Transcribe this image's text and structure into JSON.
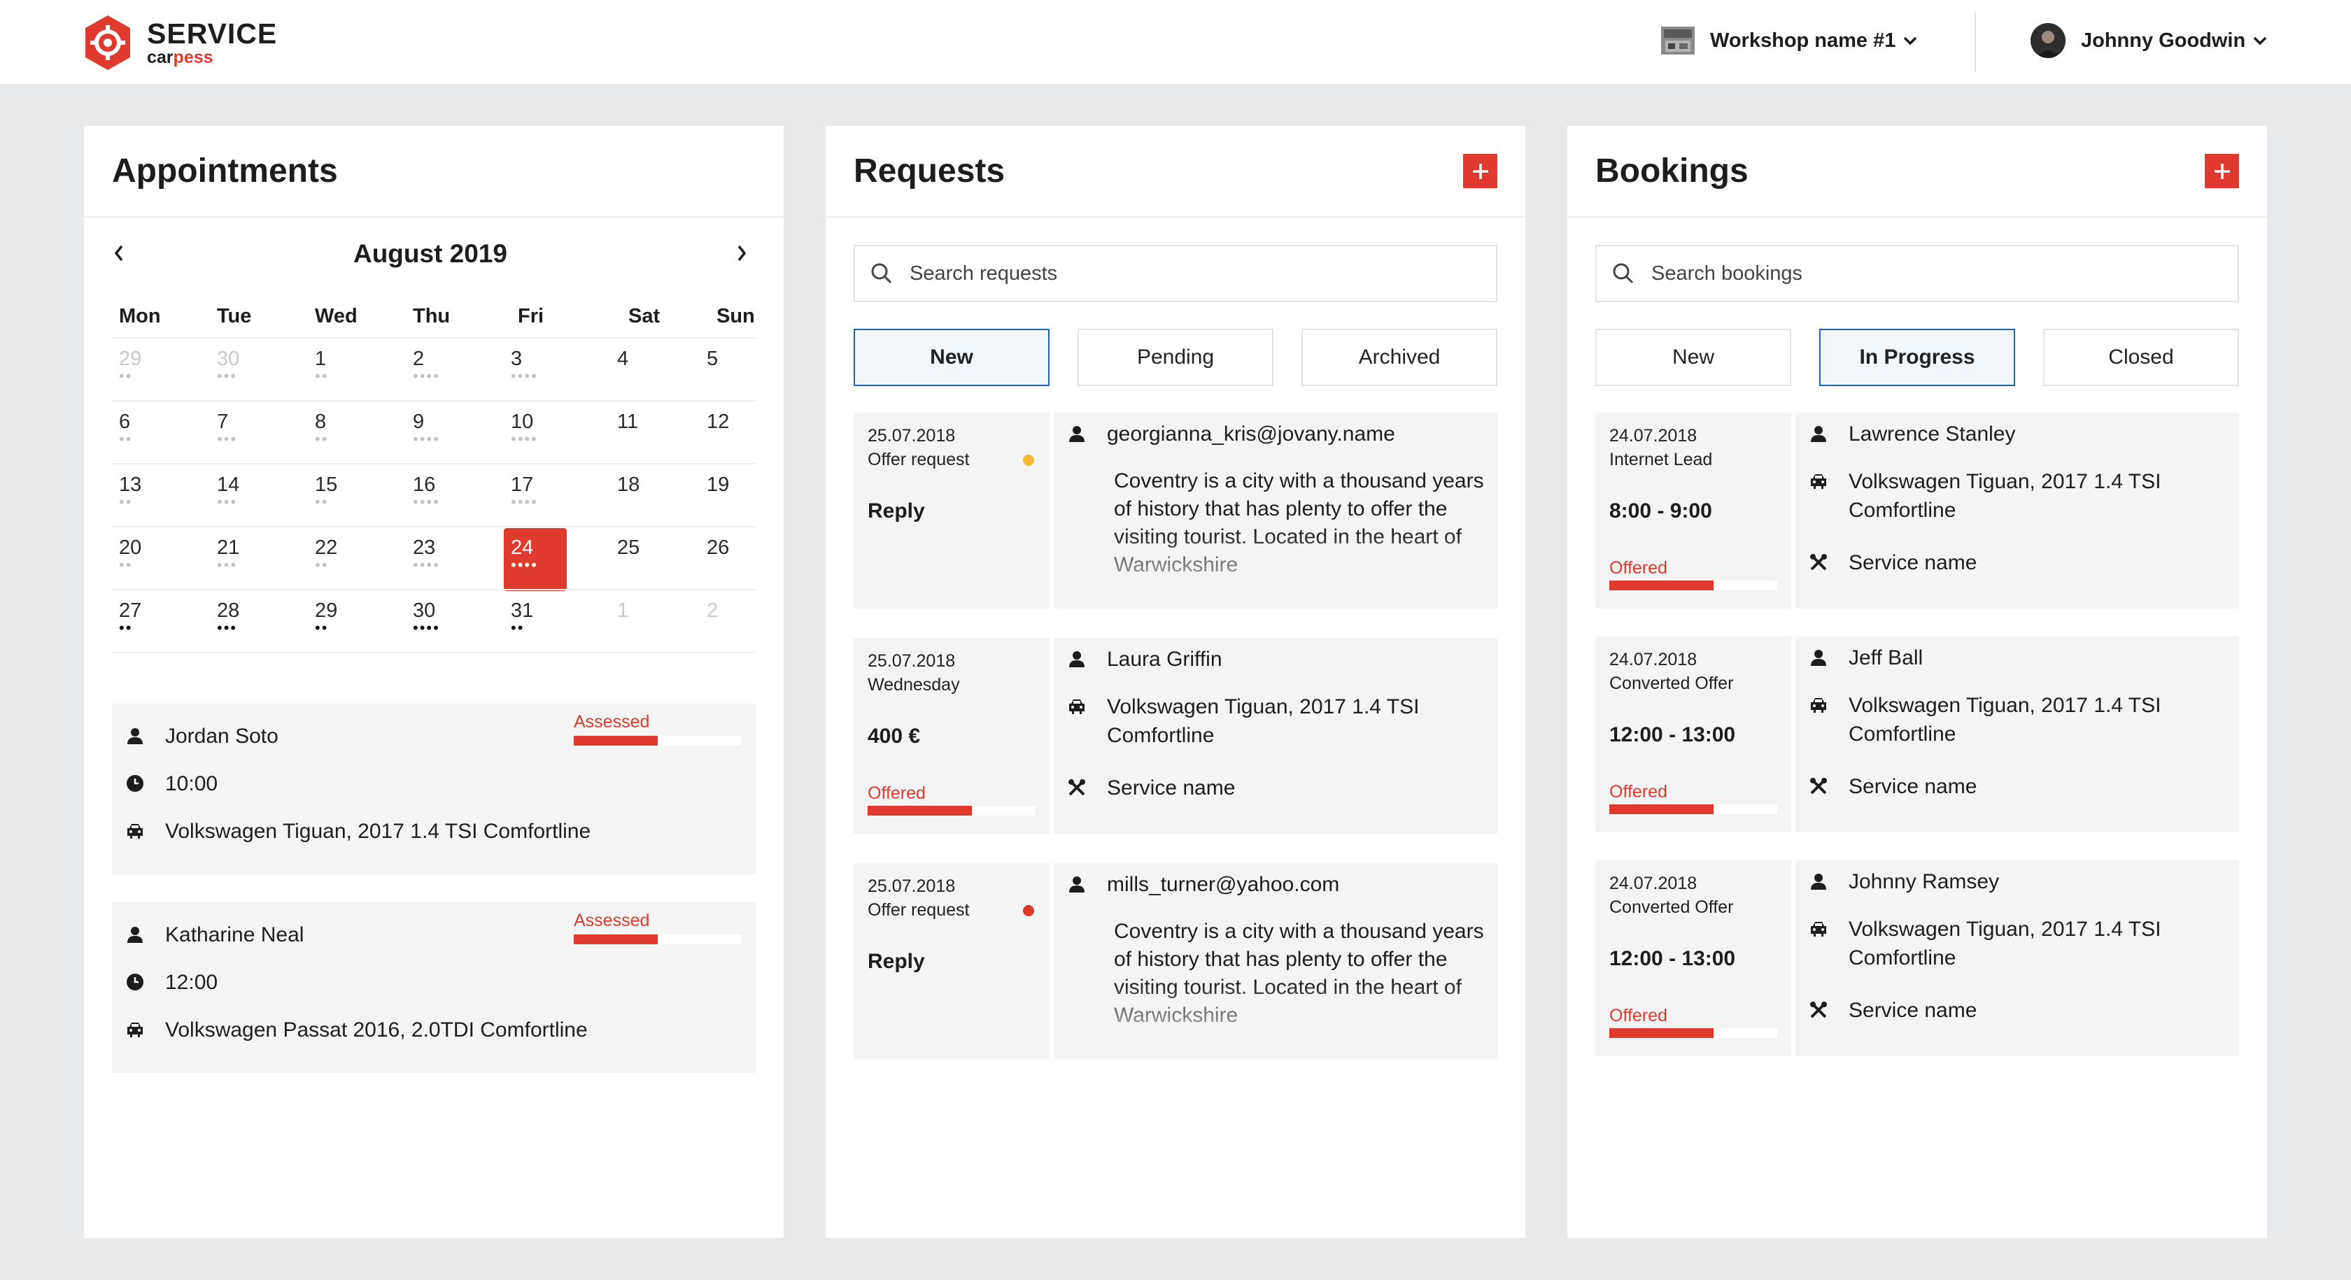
{
  "header": {
    "logo_main": "SERVICE",
    "logo_sub_a": "car",
    "logo_sub_b": "pess",
    "workshop": "Workshop name #1",
    "user": "Johnny Goodwin"
  },
  "appointments": {
    "title": "Appointments",
    "month": "August 2019",
    "weekdays": [
      "Mon",
      "Tue",
      "Wed",
      "Thu",
      "Fri",
      "Sat",
      "Sun"
    ],
    "weeks": [
      [
        {
          "d": "29",
          "m": true,
          "dots": "••"
        },
        {
          "d": "30",
          "m": true,
          "dots": "•••"
        },
        {
          "d": "1",
          "dots": "••"
        },
        {
          "d": "2",
          "dots": "••••"
        },
        {
          "d": "3",
          "dots": "••••"
        },
        {
          "d": "4"
        },
        {
          "d": "5"
        }
      ],
      [
        {
          "d": "6",
          "dots": "••"
        },
        {
          "d": "7",
          "dots": "•••"
        },
        {
          "d": "8",
          "dots": "••"
        },
        {
          "d": "9",
          "dots": "••••"
        },
        {
          "d": "10",
          "dots": "••••"
        },
        {
          "d": "11"
        },
        {
          "d": "12"
        }
      ],
      [
        {
          "d": "13",
          "dots": "••"
        },
        {
          "d": "14",
          "dots": "•••"
        },
        {
          "d": "15",
          "dots": "••"
        },
        {
          "d": "16",
          "dots": "••••"
        },
        {
          "d": "17",
          "dots": "••••"
        },
        {
          "d": "18"
        },
        {
          "d": "19"
        }
      ],
      [
        {
          "d": "20",
          "dots": "••"
        },
        {
          "d": "21",
          "dots": "•••"
        },
        {
          "d": "22",
          "dots": "••"
        },
        {
          "d": "23",
          "dots": "••••"
        },
        {
          "d": "24",
          "dots": "••••",
          "sel": true
        },
        {
          "d": "25"
        },
        {
          "d": "26"
        }
      ],
      [
        {
          "d": "27",
          "dots": "••",
          "dark": true
        },
        {
          "d": "28",
          "dots": "•••",
          "dark": true
        },
        {
          "d": "29",
          "dots": "••",
          "dark": true
        },
        {
          "d": "30",
          "dots": "••••",
          "dark": true
        },
        {
          "d": "31",
          "dots": "••",
          "dark": true
        },
        {
          "d": "1",
          "m": true
        },
        {
          "d": "2",
          "m": true
        }
      ]
    ],
    "items": [
      {
        "name": "Jordan Soto",
        "time": "10:00",
        "car": "Volkswagen Tiguan, 2017 1.4 TSI Comfortline",
        "status": "Assessed",
        "progress": 0.5
      },
      {
        "name": "Katharine Neal",
        "time": "12:00",
        "car": "Volkswagen Passat 2016, 2.0TDI Comfortline",
        "status": "Assessed",
        "progress": 0.5
      }
    ]
  },
  "requests": {
    "title": "Requests",
    "search_placeholder": "Search requests",
    "tabs": [
      "New",
      "Pending",
      "Archived"
    ],
    "active_tab": "New",
    "items": [
      {
        "date": "25.07.2018",
        "type": "Offer request",
        "action": "Reply",
        "dot_color": "#f5b82e",
        "contact": "georgianna_kris@jovany.name",
        "message": "Coventry is a city with a thousand years of history that has plenty to offer the visiting tourist. Located in the heart of Warwickshire"
      },
      {
        "date": "25.07.2018",
        "type": "Wednesday",
        "price": "400 €",
        "status": "Offered",
        "progress": 0.62,
        "contact": "Laura Griffin",
        "car": "Volkswagen Tiguan, 2017 1.4 TSI Comfortline",
        "service": "Service name"
      },
      {
        "date": "25.07.2018",
        "type": "Offer request",
        "action": "Reply",
        "dot_color": "#e03a2e",
        "contact": "mills_turner@yahoo.com",
        "message": "Coventry is a city with a thousand years of history that has plenty to offer the visiting tourist. Located in the heart of Warwickshire"
      }
    ]
  },
  "bookings": {
    "title": "Bookings",
    "search_placeholder": "Search bookings",
    "tabs": [
      "New",
      "In Progress",
      "Closed"
    ],
    "active_tab": "In Progress",
    "items": [
      {
        "date": "24.07.2018",
        "type": "Internet Lead",
        "time": "8:00 - 9:00",
        "status": "Offered",
        "progress": 0.62,
        "name": "Lawrence Stanley",
        "car": "Volkswagen Tiguan, 2017 1.4 TSI Comfortline",
        "service": "Service name"
      },
      {
        "date": "24.07.2018",
        "type": "Converted Offer",
        "time": "12:00 - 13:00",
        "status": "Offered",
        "progress": 0.62,
        "name": "Jeff Ball",
        "car": "Volkswagen Tiguan, 2017 1.4 TSI Comfortline",
        "service": "Service name"
      },
      {
        "date": "24.07.2018",
        "type": "Converted Offer",
        "time": "12:00 - 13:00",
        "status": "Offered",
        "progress": 0.62,
        "name": "Johnny Ramsey",
        "car": "Volkswagen Tiguan, 2017 1.4 TSI Comfortline",
        "service": "Service name"
      }
    ]
  },
  "colors": {
    "accent": "#e03a2e",
    "active_tab_border": "#1f63a8",
    "card_bg": "#f4f4f4"
  }
}
